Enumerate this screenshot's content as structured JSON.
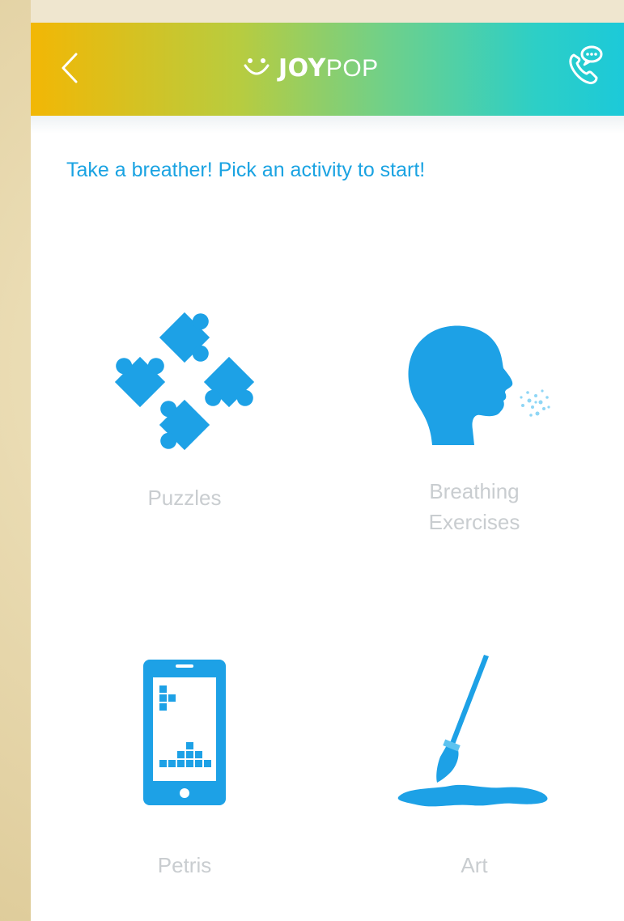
{
  "header": {
    "back_icon": "chevron-left-icon",
    "logo_prefix": "JOY",
    "logo_suffix": "POP",
    "logo_icon": "smile-icon",
    "call_icon": "phone-chat-icon",
    "gradient_colors": [
      "#f2b705",
      "#6fd08a",
      "#1cc9d9"
    ]
  },
  "prompt": "Take a breather! Pick an activity to start!",
  "activities": [
    {
      "label": "Puzzles",
      "icon": "puzzle-pieces-icon"
    },
    {
      "label": "Breathing\nExercises",
      "icon": "breathing-head-icon"
    },
    {
      "label": "Petris",
      "icon": "tetris-phone-icon"
    },
    {
      "label": "Art",
      "icon": "paintbrush-icon"
    }
  ],
  "colors": {
    "accent": "#1aa3e2",
    "icon_blue": "#1da1e6",
    "label_gray": "#c9cdd0"
  }
}
